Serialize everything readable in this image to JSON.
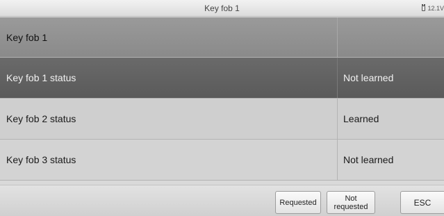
{
  "title_bar": {
    "title": "Key fob 1",
    "battery_voltage": "12.1V"
  },
  "table": {
    "header": {
      "label": "Key fob 1",
      "value": ""
    },
    "rows": [
      {
        "label": "Key fob 1 status",
        "value": "Not learned",
        "selected": true
      },
      {
        "label": "Key fob 2 status",
        "value": "Learned",
        "selected": false
      },
      {
        "label": "Key fob 3 status",
        "value": "Not learned",
        "selected": false
      }
    ]
  },
  "footer": {
    "requested_label": "Requested",
    "not_requested_label_line1": "Not",
    "not_requested_label_line2": "requested",
    "esc_label": "ESC"
  },
  "colors": {
    "header_row": "#909090",
    "selected_row": "#626262",
    "normal_row": "#cfcfcf"
  },
  "icons": {
    "battery": "battery-icon"
  }
}
